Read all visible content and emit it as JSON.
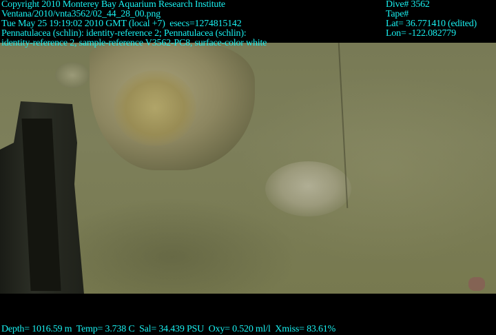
{
  "header_left": {
    "copyright": "Copyright 2010 Monterey Bay Aquarium Research Institute",
    "file_path": "Ventana/2010/vnta3562/02_44_28_00.png",
    "timestamp": "Tue May 25 19:19:02 2010 GMT (local +7)  esecs=1274815142",
    "annotation_line1": "Pennatulacea (schlin): identity-reference 2; Pennatulacea (schlin):",
    "annotation_line2": "identity-reference 2, sample-reference V3562-PC8, surface-color white"
  },
  "header_right": {
    "dive": "Dive# 3562",
    "tape": "Tape#",
    "lat": "Lat= 36.771410 (edited)",
    "lon": "Lon= -122.082779"
  },
  "footer": {
    "sensors": "Depth= 1016.59 m  Temp= 3.738 C  Sal= 34.439 PSU  Oxy= 0.520 ml/l  Xmiss= 83.61%"
  },
  "colors": {
    "overlay_text": "#19f0f0",
    "background": "#000000"
  }
}
